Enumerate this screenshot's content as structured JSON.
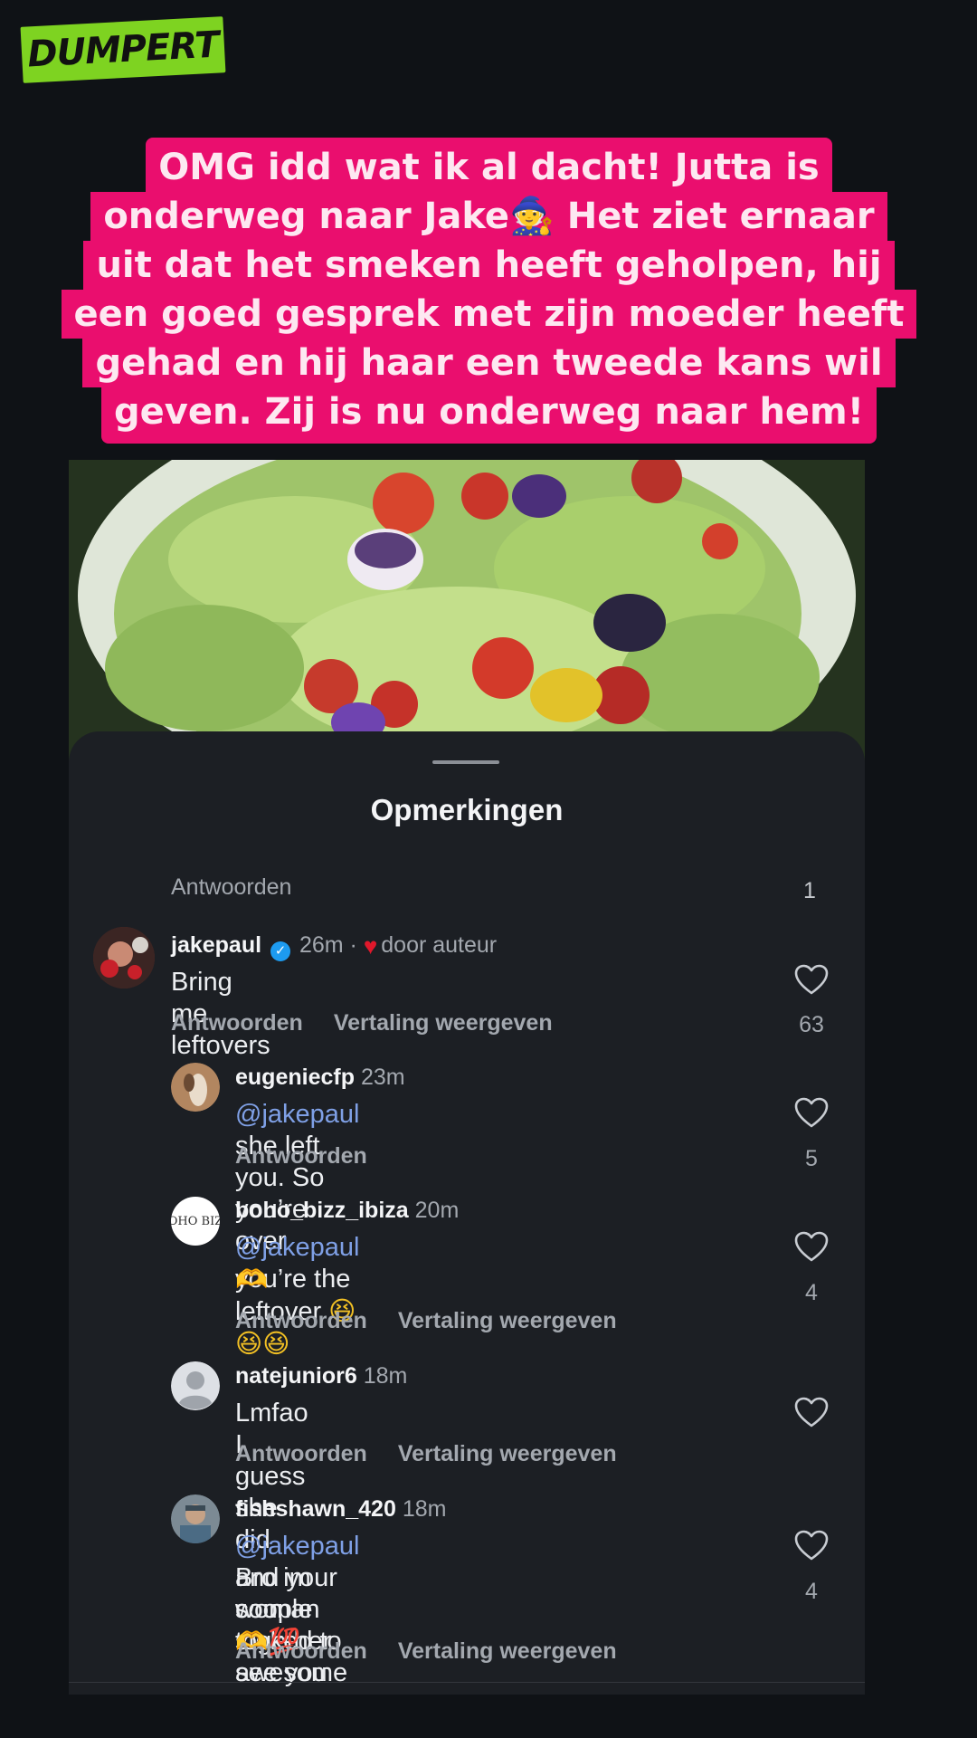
{
  "logo": {
    "text": "DUMPERT",
    "color": "#7ed321"
  },
  "banner": {
    "color": "#ea0e6e",
    "lines": [
      "OMG idd wat ik al dacht! Jutta is",
      "onderweg naar Jake🧙 Het ziet ernaar",
      "uit dat het smeken heeft geholpen, hij",
      "een goed gesprek met zijn moeder heeft",
      "gehad en hij haar een tweede kans wil",
      "geven. Zij is nu onderweg naar hem!"
    ]
  },
  "comments_sheet": {
    "title": "Opmerkingen",
    "header_reply": "Antwoorden",
    "header_count": "1",
    "reply_label": "Antwoorden",
    "translate_label": "Vertaling weergeven",
    "comments": [
      {
        "username": "jakepaul",
        "verified": true,
        "time": "26m ·",
        "author_badge": "door auteur",
        "mention": "",
        "text": "Bring me leftovers",
        "likes": "63",
        "show_translate": true
      },
      {
        "username": "eugeniecfp",
        "time": "23m",
        "mention": "@jakepaul",
        "text": " she left you. So you’re over",
        "likes": "5",
        "show_translate": false
      },
      {
        "username": "boho_bizz_ibiza",
        "avatar_text": "OHO BIZ",
        "time": "20m",
        "mention": "@jakepaul",
        "text": " you’re the leftover",
        "emoji_line1": "😆😆😆",
        "emoji_line2": "🫶",
        "likes": "4",
        "show_translate": true
      },
      {
        "username": "natejunior6",
        "time": "18m",
        "mention": "",
        "text": "Lmfao I guess she did",
        "likes": "",
        "show_translate": true
      },
      {
        "username": "fishshawn_420",
        "time": "18m",
        "mention": "@jakepaul",
        "text_line1": " Bro im soo stoked to see you",
        "text_line2": "and your woman together awesome",
        "text_line3": "couple ",
        "emoji_tail": "🫶💯",
        "likes": "4",
        "show_translate": true
      }
    ]
  }
}
